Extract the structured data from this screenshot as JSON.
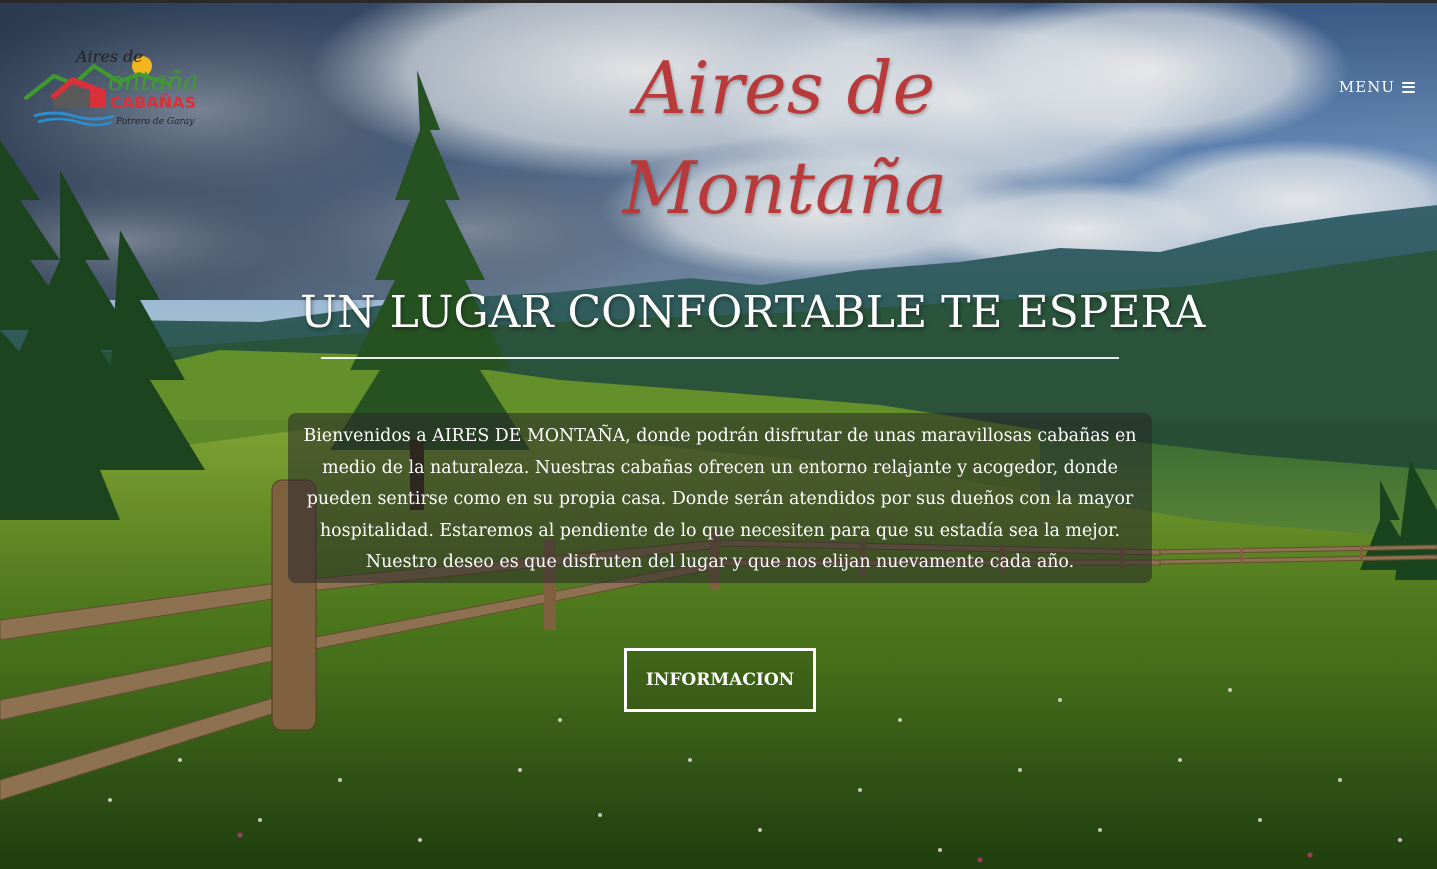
{
  "header": {
    "logo": {
      "line1": "Aires de",
      "line2": "ontaña",
      "line3": "CABAÑAS",
      "line4": "Potrero de Garay"
    },
    "site_title": "Aires de Montaña",
    "menu_label": "MENU"
  },
  "hero": {
    "headline": "UN LUGAR CONFORTABLE TE ESPERA",
    "intro_text": "Bienvenidos a AIRES DE MONTAÑA, donde podrán disfrutar de unas maravillosas cabañas en medio de la naturaleza. Nuestras cabañas ofrecen un entorno relajante y acogedor, donde pueden sentirse como en su propia casa. Donde serán atendidos por sus dueños con la mayor hospitalidad. Estaremos al pendiente de lo que necesiten para que su estadía sea la mejor. Nuestro deseo es que disfruten del lugar y que nos elijan nuevamente cada año.",
    "cta_label": "INFORMACION"
  },
  "colors": {
    "title_red": "#b93a3a",
    "logo_green": "#3f9b2f",
    "logo_red": "#d8313a",
    "logo_blue": "#2a8fd0",
    "text_white": "#ffffff"
  },
  "icons": {
    "menu": "hamburger-icon",
    "logo": "mountain-cabin-logo-icon"
  }
}
